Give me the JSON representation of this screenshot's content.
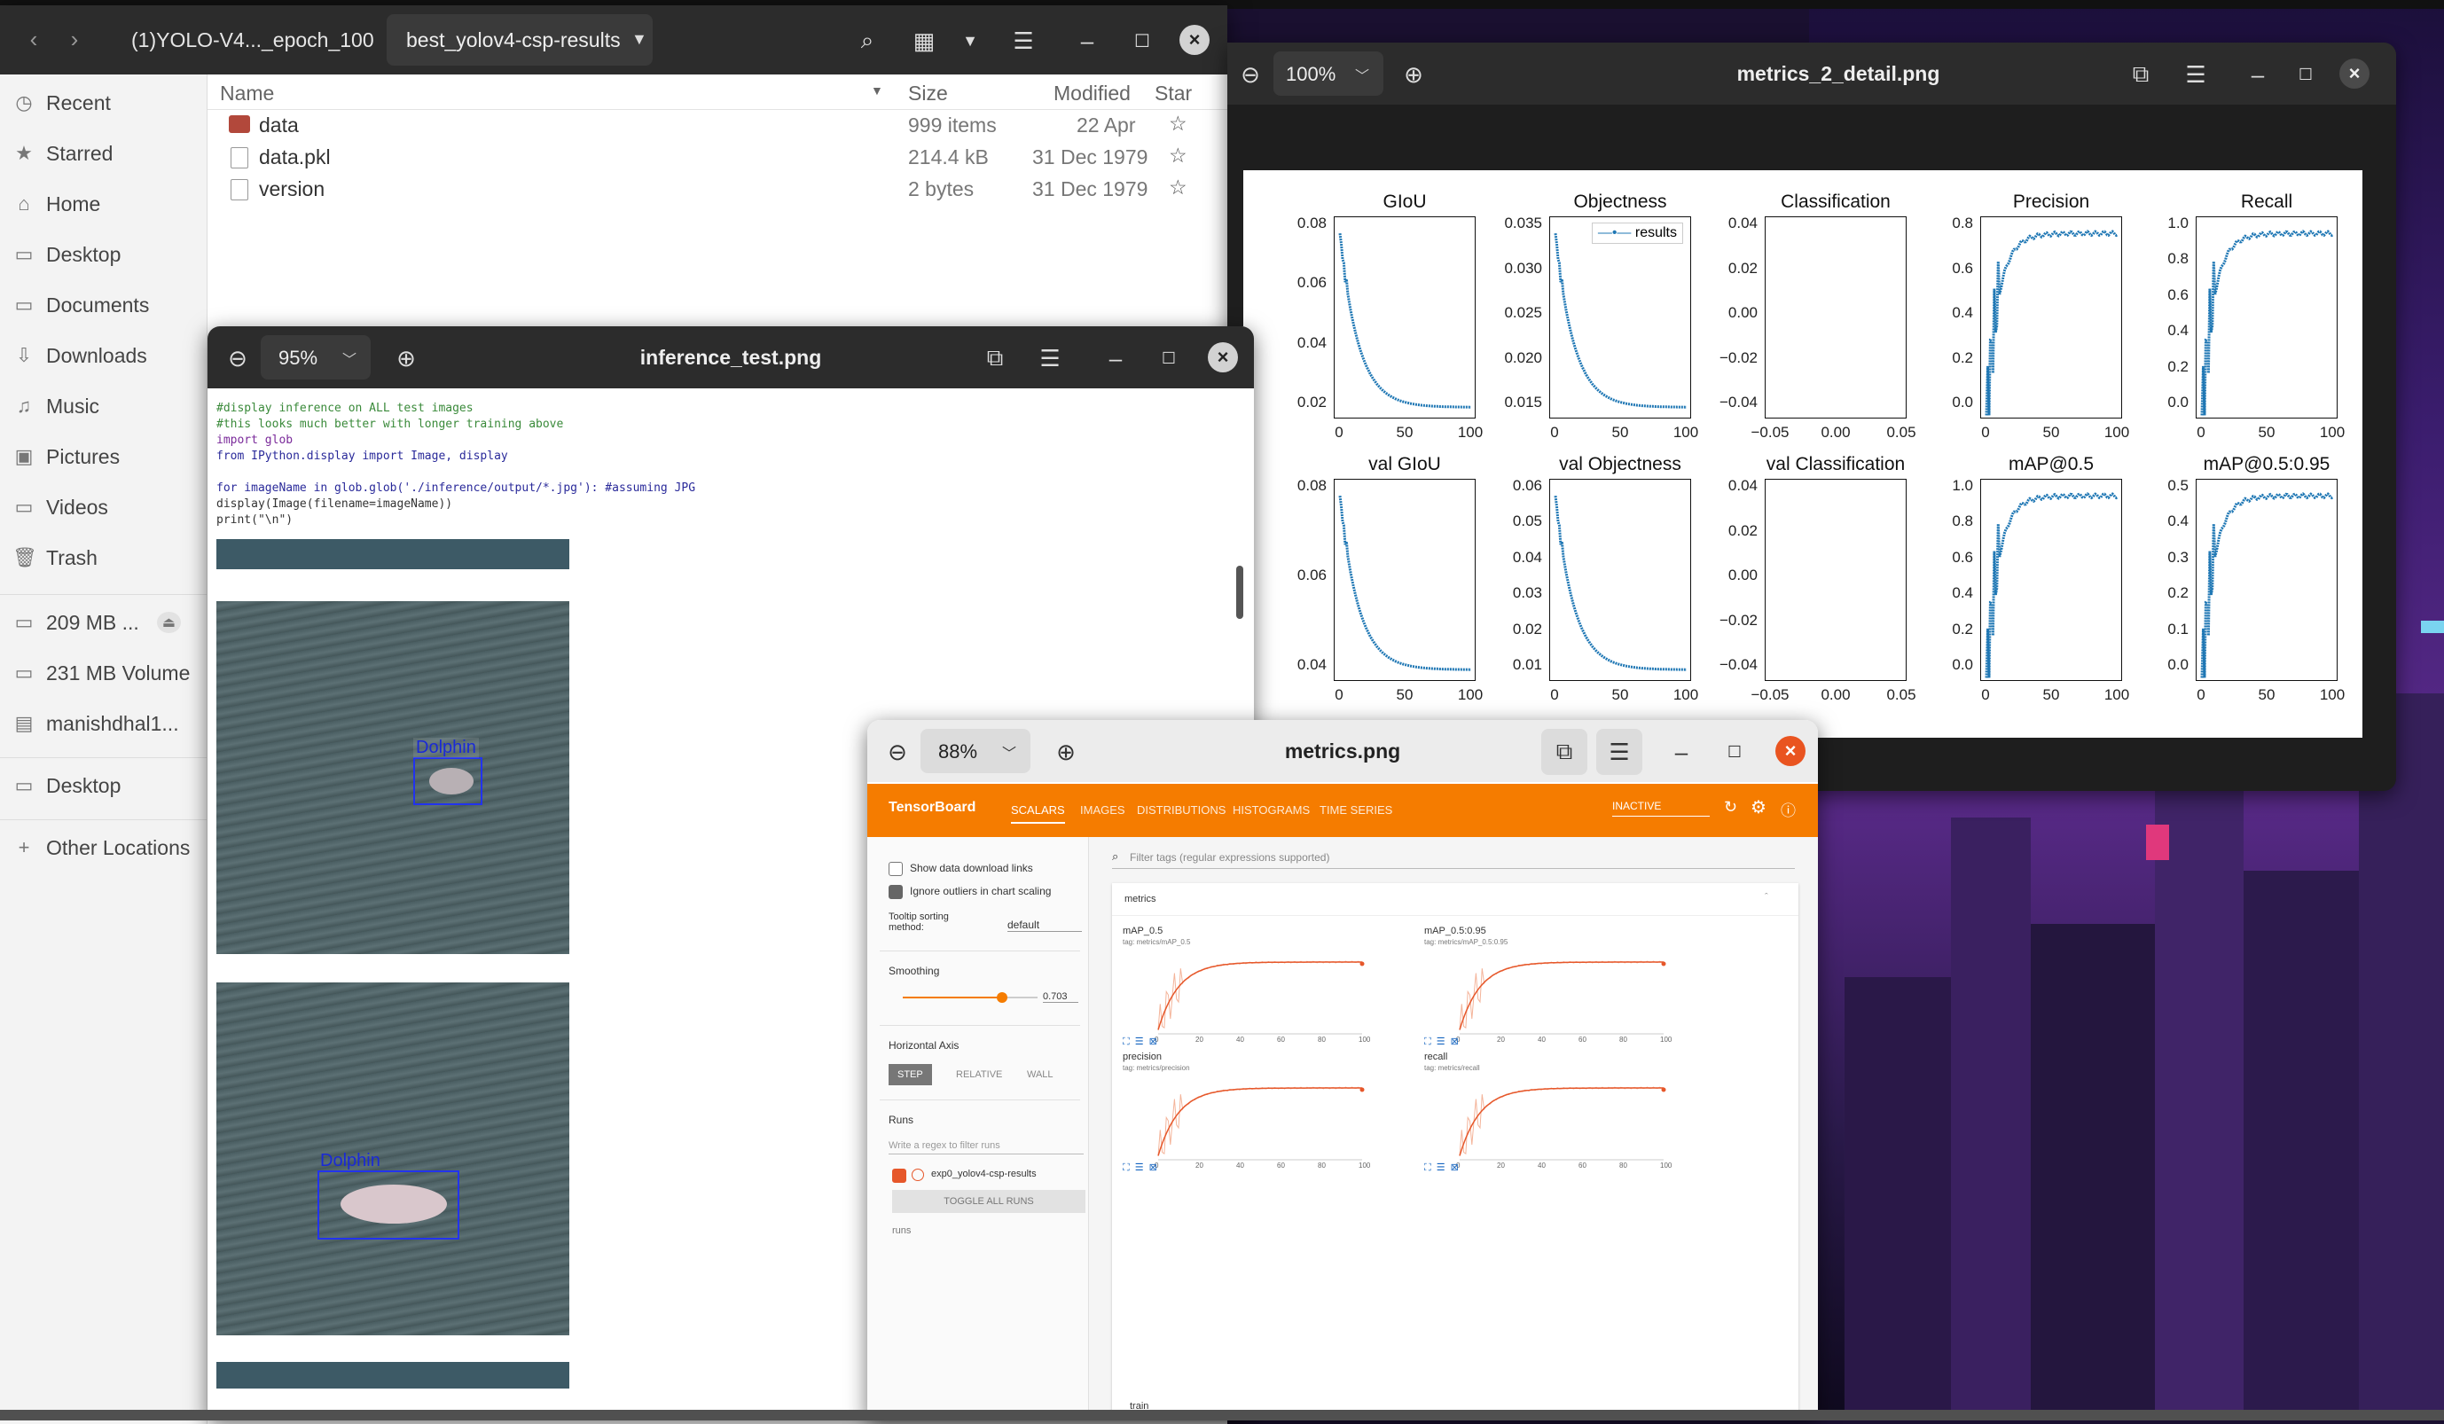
{
  "file_manager": {
    "path": [
      "(1)YOLO-V4..._epoch_100",
      "best_yolov4-csp-results"
    ],
    "columns": {
      "name": "Name",
      "size": "Size",
      "modified": "Modified",
      "star": "Star"
    },
    "rows": [
      {
        "name": "data",
        "size": "999 items",
        "modified": "22 Apr"
      },
      {
        "name": "data.pkl",
        "size": "214.4 kB",
        "modified": "31 Dec 1979"
      },
      {
        "name": "version",
        "size": "2 bytes",
        "modified": "31 Dec 1979"
      }
    ],
    "sidebar": [
      "Recent",
      "Starred",
      "Home",
      "Desktop",
      "Documents",
      "Downloads",
      "Music",
      "Pictures",
      "Videos",
      "Trash",
      "209 MB ...",
      "231 MB Volume",
      "manishdhal1...",
      "Desktop",
      "Other Locations"
    ]
  },
  "viewer_metrics2": {
    "zoom": "100%",
    "title": "metrics_2_detail.png",
    "panels": [
      {
        "title": "GIoU",
        "yticks": [
          "0.08",
          "0.06",
          "0.04",
          "0.02"
        ],
        "xticks": [
          "0",
          "50",
          "100"
        ]
      },
      {
        "title": "Objectness",
        "yticks": [
          "0.035",
          "0.030",
          "0.025",
          "0.020",
          "0.015"
        ],
        "xticks": [
          "0",
          "50",
          "100"
        ],
        "legend": "results"
      },
      {
        "title": "Classification",
        "yticks": [
          "0.04",
          "0.02",
          "0.00",
          "−0.02",
          "−0.04"
        ],
        "xticks": [
          "−0.05",
          "0.00",
          "0.05"
        ]
      },
      {
        "title": "Precision",
        "yticks": [
          "0.8",
          "0.6",
          "0.4",
          "0.2",
          "0.0"
        ],
        "xticks": [
          "0",
          "50",
          "100"
        ]
      },
      {
        "title": "Recall",
        "yticks": [
          "1.0",
          "0.8",
          "0.6",
          "0.4",
          "0.2",
          "0.0"
        ],
        "xticks": [
          "0",
          "50",
          "100"
        ]
      },
      {
        "title": "val GIoU",
        "yticks": [
          "0.08",
          "0.06",
          "0.04"
        ],
        "xticks": [
          "0",
          "50",
          "100"
        ]
      },
      {
        "title": "val Objectness",
        "yticks": [
          "0.06",
          "0.05",
          "0.04",
          "0.03",
          "0.02",
          "0.01"
        ],
        "xticks": [
          "0",
          "50",
          "100"
        ]
      },
      {
        "title": "val Classification",
        "yticks": [
          "0.04",
          "0.02",
          "0.00",
          "−0.02",
          "−0.04"
        ],
        "xticks": [
          "−0.05",
          "0.00",
          "0.05"
        ]
      },
      {
        "title": "mAP@0.5",
        "yticks": [
          "1.0",
          "0.8",
          "0.6",
          "0.4",
          "0.2",
          "0.0"
        ],
        "xticks": [
          "0",
          "50",
          "100"
        ]
      },
      {
        "title": "mAP@0.5:0.95",
        "yticks": [
          "0.5",
          "0.4",
          "0.3",
          "0.2",
          "0.1",
          "0.0"
        ],
        "xticks": [
          "0",
          "50",
          "100"
        ]
      }
    ]
  },
  "viewer_inference": {
    "zoom": "95%",
    "title": "inference_test.png",
    "code": [
      "#display inference on ALL test images",
      "#this looks much better with longer training above",
      "import glob",
      "from IPython.display import Image, display",
      "",
      "for imageName in glob.glob('./inference/output/*.jpg'): #assuming JPG",
      "    display(Image(filename=imageName))",
      "    print(\"\\n\")"
    ],
    "labels": [
      "Dolphin",
      "Dolphin"
    ]
  },
  "viewer_metrics": {
    "zoom": "88%",
    "title": "metrics.png",
    "tb": {
      "brand": "TensorBoard",
      "nav": [
        "SCALARS",
        "IMAGES",
        "DISTRIBUTIONS",
        "HISTOGRAMS",
        "TIME SERIES"
      ],
      "status": "INACTIVE",
      "show_download": "Show data download links",
      "ignore_outliers": "Ignore outliers in chart scaling",
      "tooltip_label": "Tooltip sorting method:",
      "tooltip_value": "default",
      "smoothing_label": "Smoothing",
      "smoothing_value": "0.703",
      "haxis_label": "Horizontal Axis",
      "haxis": [
        "STEP",
        "RELATIVE",
        "WALL"
      ],
      "runs_label": "Runs",
      "runs_placeholder": "Write a regex to filter runs",
      "run_name": "exp0_yolov4-csp-results",
      "toggle": "TOGGLE ALL RUNS",
      "runs_footer": "runs",
      "filter_placeholder": "Filter tags (regular expressions supported)",
      "group": "metrics",
      "group2": "train",
      "cards": [
        {
          "title": "mAP_0.5",
          "tag": "tag: metrics/mAP_0.5"
        },
        {
          "title": "mAP_0.5:0.95",
          "tag": "tag: metrics/mAP_0.5:0.95"
        },
        {
          "title": "precision",
          "tag": "tag: metrics/precision"
        },
        {
          "title": "recall",
          "tag": "tag: metrics/recall"
        }
      ],
      "xticks": [
        "0",
        "20",
        "40",
        "60",
        "80",
        "100"
      ]
    }
  }
}
